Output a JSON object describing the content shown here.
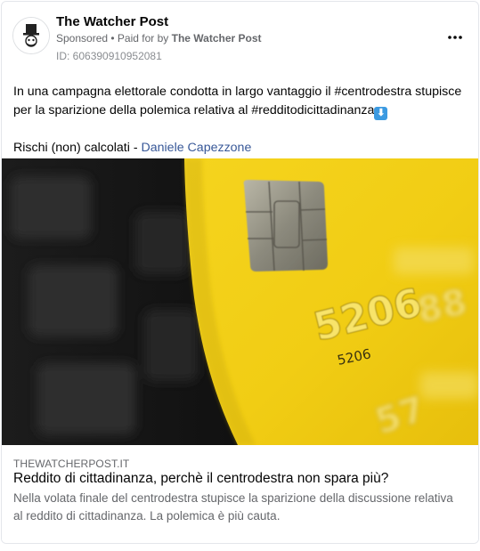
{
  "post": {
    "page_name": "The Watcher Post",
    "sponsored_label": "Sponsored",
    "separator": " • ",
    "paid_for_prefix": "Paid for by ",
    "paid_for_name": "The Watcher Post",
    "ad_id": "ID: 606390910952081",
    "more_icon": "more-horizontal-icon",
    "text_line1_part1": "In una campagna elettorale condotta in largo vantaggio il ",
    "hashtag1": "#centrodestra",
    "text_line1_part2": " stupisce per la sparizione della polemica relativa al ",
    "hashtag2": "#redditodicittadinanza",
    "emoji_down": "⬇",
    "text_line2_prefix": "Rischi (non) calcolati - ",
    "author_name": "Daniele Capezzone"
  },
  "image": {
    "card_number_large": "5206",
    "card_number_small": "5206"
  },
  "link_preview": {
    "domain": "THEWATCHERPOST.IT",
    "title": "Reddito di cittadinanza, perchè il centrodestra non spara più?",
    "description": "Nella volata finale del centrodestra stupisce la sparizione della discussione relativa al reddito di cittadinanza. La polemica è più cauta."
  },
  "colors": {
    "card_yellow": "#f2d21a",
    "link_blue": "#385898",
    "secondary_text": "#65676b"
  }
}
